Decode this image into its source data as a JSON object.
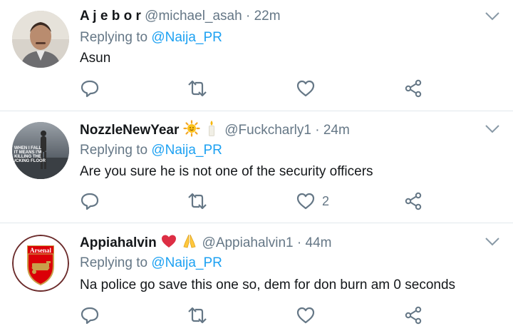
{
  "tweets": [
    {
      "display_name": "A j e b o r",
      "handle": "@michael_asah",
      "separator": "·",
      "time": "22m",
      "replying_prefix": "Replying to",
      "replying_to": "@Naija_PR",
      "text": "Asun",
      "like_count": ""
    },
    {
      "display_name": "NozzleNewYear",
      "handle": "@Fuckcharly1",
      "separator": "·",
      "time": "24m",
      "replying_prefix": "Replying to",
      "replying_to": "@Naija_PR",
      "text": "Are you sure he is not one of the security officers",
      "like_count": "2",
      "avatar_caption": "WHEN I FALL IT MEANS I'M KILLING THE FUCKING FLOOR"
    },
    {
      "display_name": "Appiahalvin",
      "handle": "@Appiahalvin1",
      "separator": "·",
      "time": "44m",
      "replying_prefix": "Replying to",
      "replying_to": "@Naija_PR",
      "text": "Na police go save this one so, dem for don burn am 0 seconds",
      "like_count": "",
      "avatar_logo_text": "Arsenal"
    }
  ],
  "icons": {
    "reply": "reply-icon",
    "retweet": "retweet-icon",
    "like": "heart-icon",
    "share": "share-icon",
    "menu": "chevron-down-icon"
  },
  "colors": {
    "primary_text": "#14171a",
    "secondary_text": "#657786",
    "link": "#1da1f2",
    "divider": "#e1e8ed"
  }
}
